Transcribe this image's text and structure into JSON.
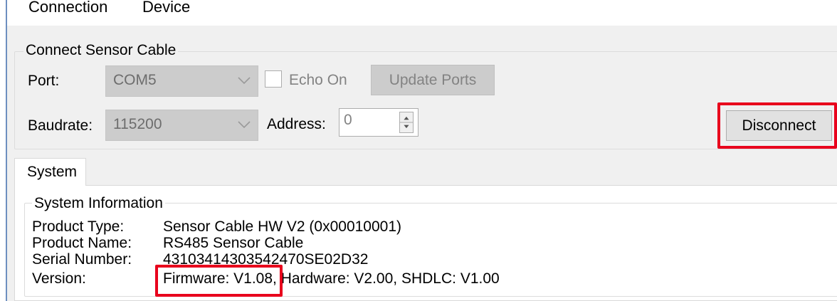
{
  "menu": {
    "connection": "Connection",
    "device": "Device"
  },
  "connect_group": {
    "title": "Connect Sensor Cable",
    "port_label": "Port:",
    "port_value": "COM5",
    "echo_label": "Echo On",
    "update_ports": "Update Ports",
    "baudrate_label": "Baudrate:",
    "baudrate_value": "115200",
    "address_label": "Address:",
    "address_value": "0",
    "disconnect": "Disconnect"
  },
  "tabs": [
    {
      "label": "System"
    }
  ],
  "system_info": {
    "title": "System Information",
    "rows": [
      {
        "label": "Product Type:",
        "value": "Sensor Cable HW V2 (0x00010001)"
      },
      {
        "label": "Product Name:",
        "value": "RS485 Sensor Cable"
      },
      {
        "label": "Serial Number:",
        "value": "43103414303542470SE02D32"
      },
      {
        "label": "Version:",
        "value": "Firmware: V1.08, Hardware: V2.00, SHDLC: V1.00"
      }
    ]
  },
  "colors": {
    "highlight": "#e8001c",
    "window_bg": "#f0f0f0",
    "disabled_bg": "#cccccc"
  },
  "icons": {
    "dropdown": "chevron-down-icon",
    "spinner": "spin-updown-icon"
  }
}
